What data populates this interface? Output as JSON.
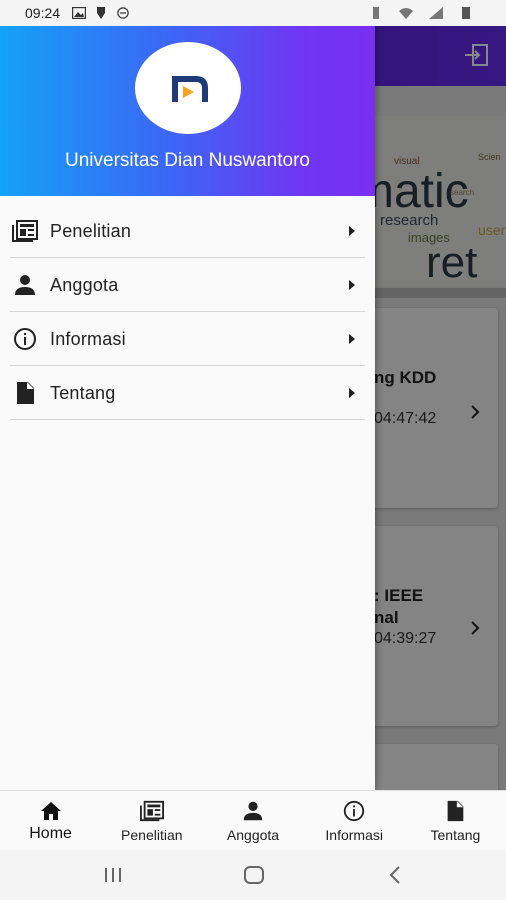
{
  "status_bar": {
    "time": "09:24",
    "left_icons": [
      "image-icon",
      "notification-icon",
      "minus-circle-icon"
    ],
    "right_icons": [
      "vibrate-icon",
      "wifi-icon",
      "signal-icon",
      "battery-icon"
    ]
  },
  "background": {
    "appbar_icon": "logout-icon",
    "wordcloud": [
      "matic",
      "research",
      "images",
      "user",
      "visual",
      "ret",
      "search",
      "Scien"
    ],
    "cards": [
      {
        "title_line1": "ng KDD",
        "title_line2": "",
        "time": "04:47:42"
      },
      {
        "title_line1": " : IEEE",
        "title_line2": "nal",
        "time": "04:39:27"
      }
    ]
  },
  "drawer": {
    "header_title": "Universitas Dian Nuswantoro",
    "logo": "udinus-logo",
    "items": [
      {
        "label": "Penelitian",
        "icon": "newspaper-icon"
      },
      {
        "label": "Anggota",
        "icon": "person-icon"
      },
      {
        "label": "Informasi",
        "icon": "info-icon"
      },
      {
        "label": "Tentang",
        "icon": "document-icon"
      }
    ]
  },
  "bottom_nav": {
    "items": [
      {
        "label": "Home",
        "icon": "home-icon",
        "active": true
      },
      {
        "label": "Penelitian",
        "icon": "newspaper-icon"
      },
      {
        "label": "Anggota",
        "icon": "person-icon"
      },
      {
        "label": "Informasi",
        "icon": "info-icon"
      },
      {
        "label": "Tentang",
        "icon": "document-icon"
      }
    ]
  },
  "system_nav": [
    "recents-button",
    "home-button",
    "back-button"
  ],
  "colors": {
    "header_gradient_start": "#14a2f7",
    "header_gradient_end": "#7a2ff0",
    "logo_orange": "#f4a321",
    "logo_navy": "#1f3a78"
  }
}
